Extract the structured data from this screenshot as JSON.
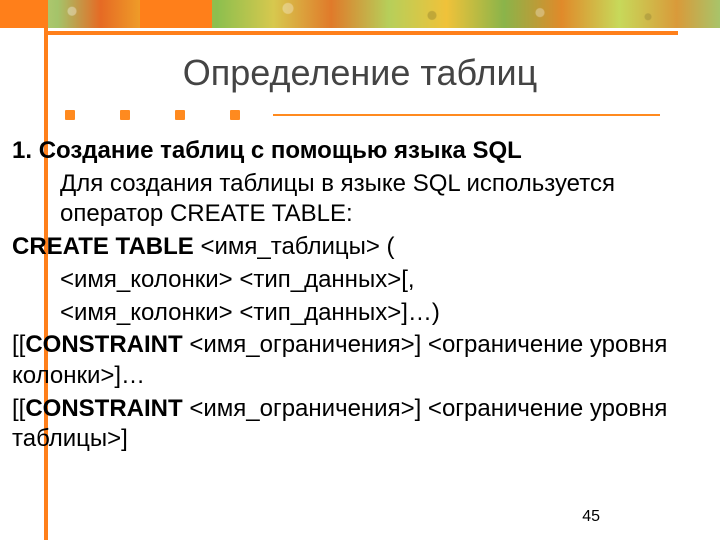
{
  "title": "Определение таблиц",
  "body": {
    "h1_prefix": "1. ",
    "h1": "Создание таблиц с помощью языка SQL",
    "intro": "Для создания таблицы в языке SQL используется оператор CREATE TABLE:",
    "line_create_kw": "CREATE TABLE",
    "line_create_rest": " <имя_таблицы> (",
    "line_col1": "<имя_колонки> <тип_данных>[,",
    "line_col2": "<имя_колонки> <тип_данных>]…)",
    "line_constraint1_pre": "[[",
    "line_constraint_kw": "CONSTRAINT",
    "line_constraint1_post": " <имя_ограничения>] <ограничение уровня колонки>]…",
    "line_constraint2_pre": "[[",
    "line_constraint2_post": " <имя_ограничения>] <ограничение уровня таблицы>]"
  },
  "page_number": "45"
}
